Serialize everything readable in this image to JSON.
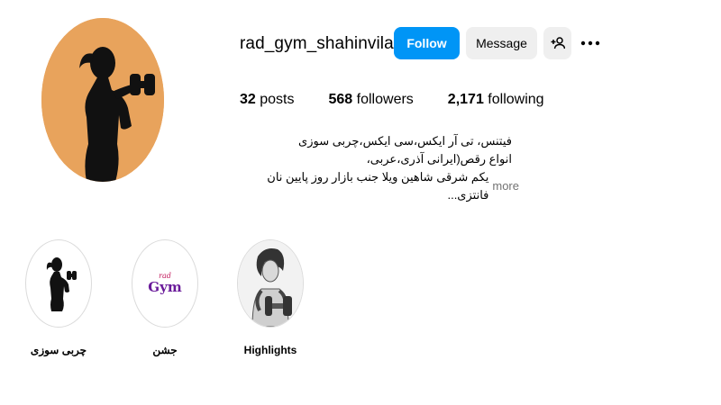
{
  "profile": {
    "username": "rad_gym_shahinvila",
    "avatar_bg": "#e8a35c",
    "follow_label": "Follow",
    "message_label": "Message",
    "stats": {
      "posts_count": "32",
      "posts_label": "posts",
      "followers_count": "568",
      "followers_label": "followers",
      "following_count": "2,171",
      "following_label": "following"
    },
    "bio": {
      "line1": "فیتنس، تی آر ایکس،سی ایکس،چربی سوزی",
      "line2": "انواع رقص(ایرانی آذری،عربی،",
      "line3": "یکم شرقی شاهین ویلا جنب بازار روز پایین نان فانتزی...",
      "more_label": "more"
    }
  },
  "highlights": [
    {
      "label": "چربی سوزی",
      "icon": "silhouette-dumbbell"
    },
    {
      "label": "جشن",
      "icon": "gym-logo"
    },
    {
      "label": "Highlights",
      "icon": "woman-dumbbell-sketch"
    }
  ],
  "colors": {
    "accent": "#0095f6",
    "secondary_button": "#efefef",
    "muted_text": "#737373"
  }
}
